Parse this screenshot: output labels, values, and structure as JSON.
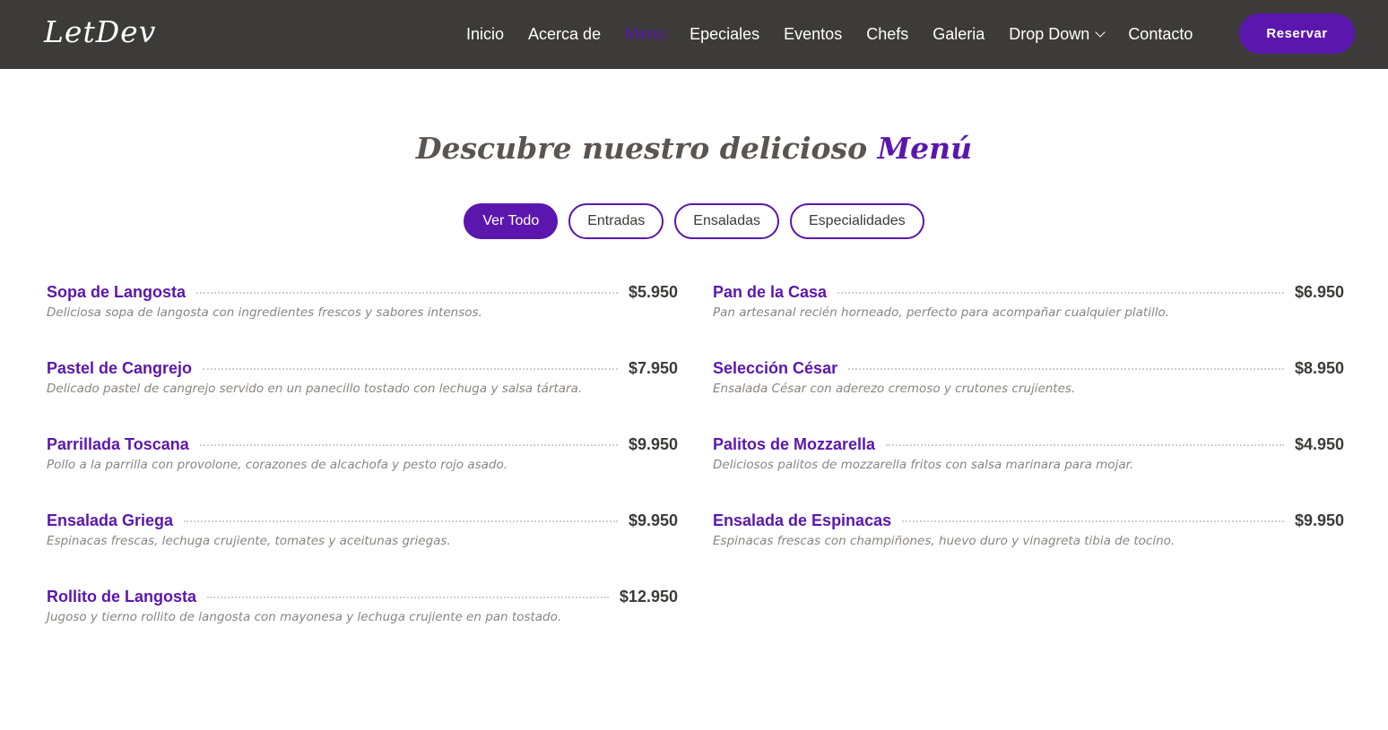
{
  "brand": {
    "logo": "LetDev"
  },
  "nav": {
    "items": [
      {
        "label": "Inicio",
        "active": false
      },
      {
        "label": "Acerca de",
        "active": false
      },
      {
        "label": "Menu",
        "active": true
      },
      {
        "label": "Epeciales",
        "active": false
      },
      {
        "label": "Eventos",
        "active": false
      },
      {
        "label": "Chefs",
        "active": false
      },
      {
        "label": "Galeria",
        "active": false
      },
      {
        "label": "Drop Down",
        "active": false,
        "dropdown": true
      },
      {
        "label": "Contacto",
        "active": false
      }
    ],
    "cta_label": "Reservar"
  },
  "section": {
    "title_main": "Descubre nuestro delicioso ",
    "title_accent": "Menú"
  },
  "filters": [
    {
      "label": "Ver Todo",
      "active": true
    },
    {
      "label": "Entradas",
      "active": false
    },
    {
      "label": "Ensaladas",
      "active": false
    },
    {
      "label": "Especialidades",
      "active": false
    }
  ],
  "menu": {
    "left": [
      {
        "name": "Sopa de Langosta",
        "price": "$5.950",
        "desc": "Deliciosa sopa de langosta con ingredientes frescos y sabores intensos."
      },
      {
        "name": "Pastel de Cangrejo",
        "price": "$7.950",
        "desc": "Delicado pastel de cangrejo servido en un panecillo tostado con lechuga y salsa tártara."
      },
      {
        "name": "Parrillada Toscana",
        "price": "$9.950",
        "desc": "Pollo a la parrilla con provolone, corazones de alcachofa y pesto rojo asado."
      },
      {
        "name": "Ensalada Griega",
        "price": "$9.950",
        "desc": "Espinacas frescas, lechuga crujiente, tomates y aceitunas griegas."
      },
      {
        "name": "Rollito de Langosta",
        "price": "$12.950",
        "desc": "Jugoso y tierno rollito de langosta con mayonesa y lechuga crujiente en pan tostado."
      }
    ],
    "right": [
      {
        "name": "Pan de la Casa",
        "price": "$6.950",
        "desc": "Pan artesanal recién horneado, perfecto para acompañar cualquier platillo."
      },
      {
        "name": "Selección César",
        "price": "$8.950",
        "desc": "Ensalada César con aderezo cremoso y crutones crujientes."
      },
      {
        "name": "Palitos de Mozzarella",
        "price": "$4.950",
        "desc": "Deliciosos palitos de mozzarella fritos con salsa marinara para mojar."
      },
      {
        "name": "Ensalada de Espinacas",
        "price": "$9.950",
        "desc": "Espinacas frescas con champiñones, huevo duro y vinagreta tibia de tocino."
      }
    ]
  },
  "colors": {
    "navbar_bg": "#3c3b39",
    "accent": "#5b17ad",
    "text_dark": "#3c3b39",
    "desc_text": "#8a8580"
  }
}
